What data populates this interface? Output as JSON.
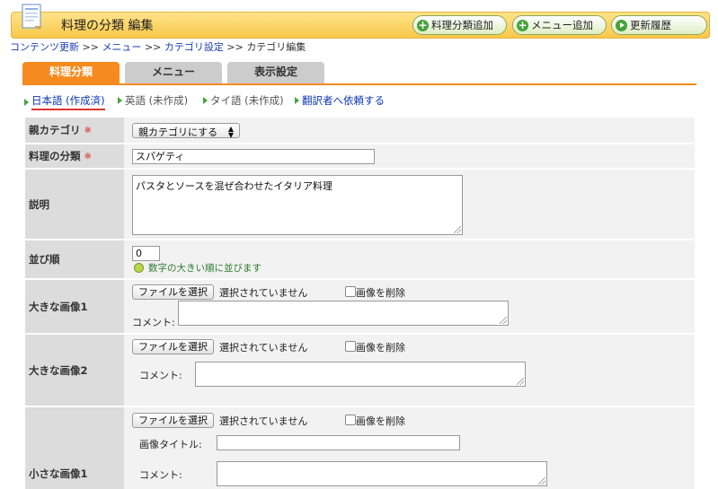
{
  "header": {
    "title": "料理の分類 編集",
    "buttons": [
      {
        "label": "料理分類追加",
        "icon": "plus-icon"
      },
      {
        "label": "メニュー追加",
        "icon": "plus-icon"
      },
      {
        "label": "更新履歴",
        "icon": "play-icon"
      }
    ]
  },
  "breadcrumb": {
    "items": [
      "コンテンツ更新",
      "メニュー",
      "カテゴリ設定",
      "カテゴリ編集"
    ],
    "separator": ">>"
  },
  "tabs": [
    {
      "label": "料理分類",
      "active": true
    },
    {
      "label": "メニュー",
      "active": false
    },
    {
      "label": "表示設定",
      "active": false
    }
  ],
  "languages": [
    {
      "label": "日本語 (作成済)",
      "state": "current"
    },
    {
      "label": "英語 (未作成)",
      "state": "inactive"
    },
    {
      "label": "タイ語 (未作成)",
      "state": "inactive"
    },
    {
      "label": "翻訳者へ依頼する",
      "state": "link"
    }
  ],
  "form": {
    "required_mark": "※",
    "parent_category": {
      "label": "親カテゴリ",
      "selected": "親カテゴリにする"
    },
    "category_name": {
      "label": "料理の分類",
      "value": "スパゲティ"
    },
    "description": {
      "label": "説明",
      "value": "パスタとソースを混ぜ合わせたイタリア料理"
    },
    "sort_order": {
      "label": "並び順",
      "value": "0",
      "hint": "数字の大きい順に並びます"
    },
    "file_button": "ファイルを選択",
    "no_file": "選択されていません",
    "delete_image": "画像を削除",
    "comment_label": "コメント:",
    "large_image_1": {
      "label": "大きな画像1"
    },
    "large_image_2": {
      "label": "大きな画像2"
    },
    "small_image_1": {
      "label": "小さな画像1",
      "title_label": "画像タイトル:"
    }
  },
  "colors": {
    "accent": "#f58b1f",
    "link": "#0b37b4",
    "header": "#f9c84a",
    "required": "#e02020"
  }
}
